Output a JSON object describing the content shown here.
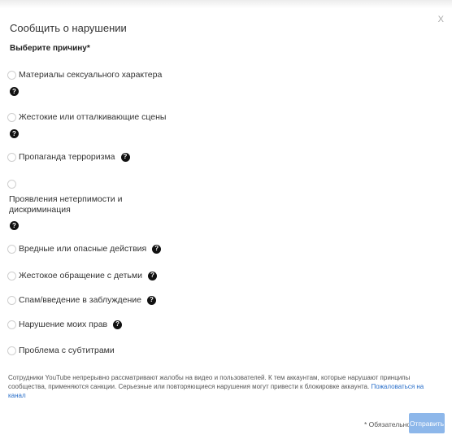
{
  "dialog": {
    "title": "Сообщить о нарушении",
    "close_label": "X",
    "subtitle": "Выберите причину*"
  },
  "options": [
    {
      "label": "Материалы сексуального характера"
    },
    {
      "label": "Жестокие или отталкивающие сцены"
    },
    {
      "label": "Пропаганда терроризма"
    },
    {
      "label": "Проявления нетерпимости и дискриминация"
    },
    {
      "label": "Вредные или опасные действия"
    },
    {
      "label": "Жестокое обращение с детьми"
    },
    {
      "label": "Спам/введение в заблуждение"
    },
    {
      "label": "Нарушение моих прав"
    },
    {
      "label": "Проблема с субтитрами"
    }
  ],
  "help_glyph": "?",
  "footer": {
    "text": "Сотрудники YouTube непрерывно рассматривают жалобы на видео и пользователей. К тем аккаунтам, которые нарушают принципы сообщества, применяются санкции. Серьезные или повторяющиеся нарушения могут привести к блокировке аккаунта. ",
    "link": "Пожаловаться на канал",
    "required_note": "* Обязательно",
    "submit_label": "Отправить"
  },
  "colors": {
    "accent": "#8db7ea",
    "link": "#2a6fc9"
  }
}
